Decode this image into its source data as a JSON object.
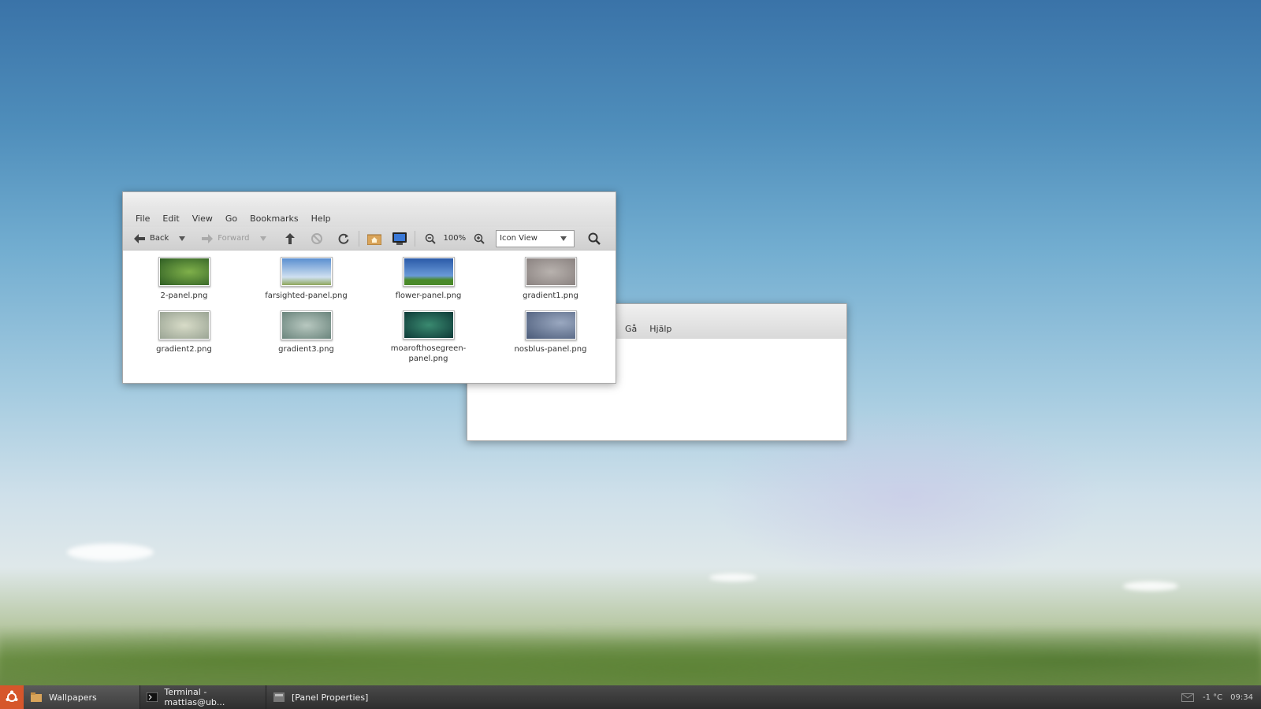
{
  "file_manager": {
    "menu": [
      "File",
      "Edit",
      "View",
      "Go",
      "Bookmarks",
      "Help"
    ],
    "toolbar": {
      "back_label": "Back",
      "forward_label": "Forward",
      "zoom_level": "100%",
      "view_mode": "Icon View"
    },
    "files": [
      {
        "name": "2-panel.png"
      },
      {
        "name": "farsighted-panel.png"
      },
      {
        "name": "flower-panel.png"
      },
      {
        "name": "gradient1.png"
      },
      {
        "name": "gradient2.png"
      },
      {
        "name": "gradient3.png"
      },
      {
        "name": "moarofthosegreen-panel.png"
      },
      {
        "name": "nosblus-panel.png"
      }
    ]
  },
  "back_window": {
    "menu": [
      "Gå",
      "Hjälp"
    ]
  },
  "taskbar": {
    "tasks": [
      {
        "label": "Wallpapers",
        "icon": "folder-icon"
      },
      {
        "label": "Terminal - mattias@ub...",
        "icon": "terminal-icon"
      },
      {
        "label": "[Panel Properties]",
        "icon": "panel-properties-icon"
      }
    ],
    "weather": "-1 °C",
    "clock": "09:34"
  },
  "colors": {
    "start_button": "#d6562b",
    "taskbar": "#333333"
  }
}
